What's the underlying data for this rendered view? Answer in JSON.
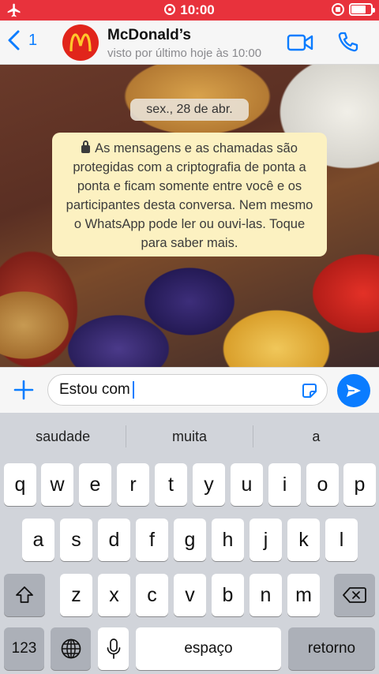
{
  "status_bar": {
    "time": "10:00"
  },
  "header": {
    "back_count": "1",
    "contact_name": "McDonald’s",
    "last_seen": "visto por último hoje às 10:00"
  },
  "chat": {
    "date_label": "sex., 28 de abr.",
    "encryption_notice": "As mensagens e as chamadas são protegidas com a criptografia de ponta a ponta e ficam somente entre você e os participantes desta conversa. Nem mesmo o WhatsApp pode ler ou ouvi-las. Toque para saber mais."
  },
  "composer": {
    "text": "Estou com"
  },
  "keyboard": {
    "suggestions": [
      "saudade",
      "muita",
      "a"
    ],
    "row1": [
      "q",
      "w",
      "e",
      "r",
      "t",
      "y",
      "u",
      "i",
      "o",
      "p"
    ],
    "row2": [
      "a",
      "s",
      "d",
      "f",
      "g",
      "h",
      "j",
      "k",
      "l"
    ],
    "row3": [
      "z",
      "x",
      "c",
      "v",
      "b",
      "n",
      "m"
    ],
    "numbers_label": "123",
    "space_label": "espaço",
    "return_label": "retorno"
  },
  "colors": {
    "status_bar": "#e8323c",
    "accent": "#0a7cff",
    "notice_bg": "#fcf1c1",
    "brand_red": "#e1251b",
    "brand_yellow": "#ffc72c"
  },
  "icons": {
    "status": [
      "airplane-icon",
      "alarm-icon",
      "rotation-lock-icon",
      "battery-icon"
    ],
    "header": [
      "back-chevron-icon",
      "mcdonalds-logo",
      "video-call-icon",
      "phone-call-icon"
    ],
    "composer": [
      "plus-icon",
      "sticker-icon",
      "send-icon"
    ],
    "keyboard": [
      "shift-icon",
      "backspace-icon",
      "globe-icon",
      "microphone-icon"
    ]
  }
}
